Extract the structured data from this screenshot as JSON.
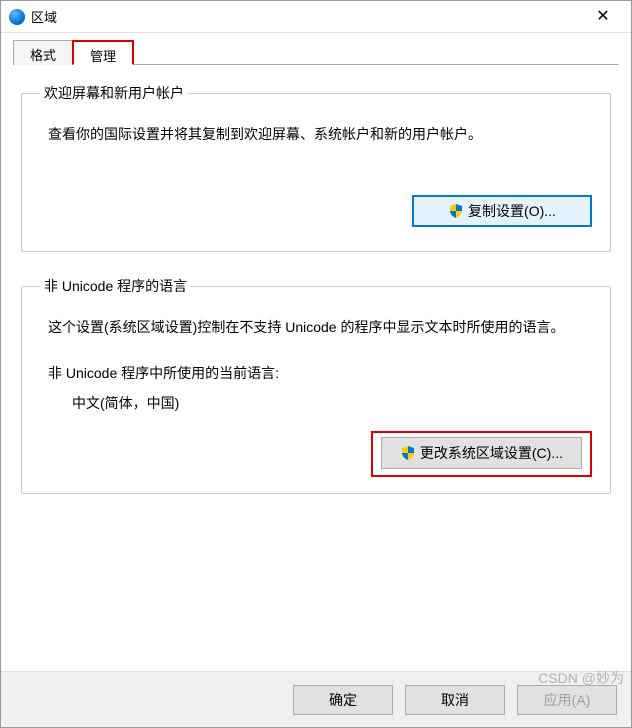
{
  "titlebar": {
    "title": "区域"
  },
  "tabs": {
    "items": [
      {
        "label": "格式"
      },
      {
        "label": "管理"
      }
    ]
  },
  "welcome": {
    "legend": "欢迎屏幕和新用户帐户",
    "desc": "查看你的国际设置并将其复制到欢迎屏幕、系统帐户和新的用户帐户。",
    "copy_btn": "复制设置(O)..."
  },
  "nonunicode": {
    "legend": "非 Unicode 程序的语言",
    "desc": "这个设置(系统区域设置)控制在不支持 Unicode 的程序中显示文本时所使用的语言。",
    "current_label": "非 Unicode 程序中所使用的当前语言:",
    "current_value": "中文(简体，中国)",
    "change_btn": "更改系统区域设置(C)..."
  },
  "footer": {
    "ok": "确定",
    "cancel": "取消",
    "apply": "应用(A)"
  },
  "watermark": "CSDN @妙为"
}
